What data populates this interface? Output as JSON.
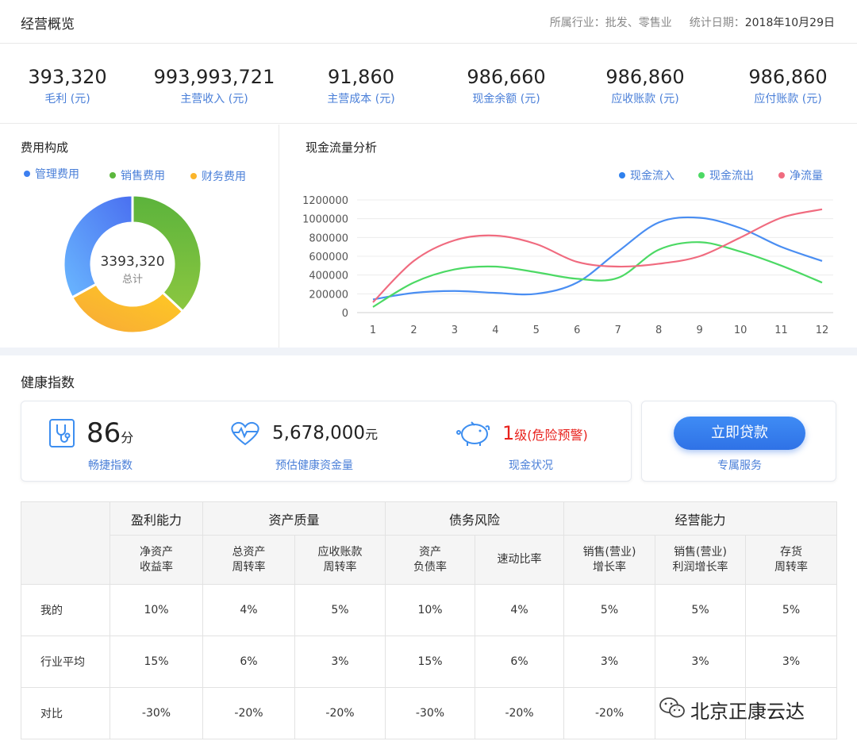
{
  "header": {
    "title": "经营概览",
    "industry": "所属行业：批发、零售业",
    "date_label": "统计日期：",
    "date_value": "2018年10月29日"
  },
  "kpis": [
    {
      "value": "393,320",
      "label": "毛利 (元)"
    },
    {
      "value": "993,993,721",
      "label": "主营收入 (元)"
    },
    {
      "value": "91,860",
      "label": "主营成本 (元)"
    },
    {
      "value": "986,660",
      "label": "现金余额 (元)"
    },
    {
      "value": "986,860",
      "label": "应收账款 (元)"
    },
    {
      "value": "986,860",
      "label": "应付账款 (元)"
    }
  ],
  "expense": {
    "title": "费用构成",
    "legend": [
      "管理费用",
      "销售费用",
      "财务费用"
    ],
    "total_value": "3393,320",
    "total_label": "总计"
  },
  "cash": {
    "title": "现金流量分析",
    "legend": [
      "现金流入",
      "现金流出",
      "净流量"
    ]
  },
  "health": {
    "title": "健康指数",
    "score_value": "86",
    "score_unit": "分",
    "score_label": "畅捷指数",
    "fund_value": "5,678,000",
    "fund_unit": "元",
    "fund_label": "预估健康资金量",
    "cash_level": "1",
    "cash_level_suffix": "级(危险预警)",
    "cash_label": "现金状况",
    "loan_button": "立即贷款",
    "loan_label": "专属服务"
  },
  "table": {
    "groups": [
      "盈利能力",
      "资产质量",
      "债务风险",
      "经营能力"
    ],
    "subheaders": [
      [
        "净资产",
        "收益率"
      ],
      [
        "总资产",
        "周转率"
      ],
      [
        "应收账款",
        "周转率"
      ],
      [
        "资产",
        "负债率"
      ],
      [
        "速动比率"
      ],
      [
        "销售(营业)",
        "增长率"
      ],
      [
        "销售(营业)",
        "利润增长率"
      ],
      [
        "存货",
        "周转率"
      ]
    ],
    "rows": [
      {
        "label": "我的",
        "cells": [
          "10%",
          "4%",
          "5%",
          "10%",
          "4%",
          "5%",
          "5%",
          "5%"
        ]
      },
      {
        "label": "行业平均",
        "cells": [
          "15%",
          "6%",
          "3%",
          "15%",
          "6%",
          "3%",
          "3%",
          "3%"
        ]
      },
      {
        "label": "对比",
        "cells": [
          "-30%",
          "-20%",
          "-20%",
          "-30%",
          "-20%",
          "-20%",
          "",
          ""
        ]
      }
    ]
  },
  "watermark": {
    "text": "北京正康云达",
    "icon": "wechat-icon"
  },
  "colors": {
    "accent": "#4a7fd8",
    "blue": "#4a8ef2",
    "green": "#4cd964",
    "red": "#f06b7f",
    "orange": "#fbb52b",
    "danger": "#e8211c"
  },
  "chart_data": [
    {
      "type": "pie",
      "categories": [
        "管理费用",
        "销售费用",
        "财务费用"
      ],
      "values": [
        33,
        37,
        30
      ],
      "colors": [
        "#4a7ff0",
        "#5cb73d",
        "#fbb52b"
      ],
      "legend": "top"
    },
    {
      "type": "line",
      "x": [
        1,
        2,
        3,
        4,
        5,
        6,
        7,
        8,
        9,
        10,
        11,
        12
      ],
      "series": [
        {
          "name": "现金流入",
          "color": "#4a8ef2",
          "values": [
            140000,
            210000,
            230000,
            210000,
            200000,
            320000,
            650000,
            960000,
            1010000,
            900000,
            700000,
            550000
          ]
        },
        {
          "name": "现金流出",
          "color": "#4cd964",
          "values": [
            60000,
            320000,
            460000,
            490000,
            430000,
            360000,
            370000,
            670000,
            750000,
            650000,
            500000,
            320000
          ]
        },
        {
          "name": "净流量",
          "color": "#f06b7f",
          "values": [
            110000,
            550000,
            770000,
            820000,
            730000,
            540000,
            490000,
            520000,
            600000,
            800000,
            1010000,
            1100000
          ]
        }
      ],
      "yticks": [
        "0",
        "200000",
        "400000",
        "600000",
        "800000",
        "1000000",
        "1200000"
      ],
      "ylim": [
        0,
        1200000
      ],
      "grid": true,
      "legend": "top-right"
    }
  ]
}
